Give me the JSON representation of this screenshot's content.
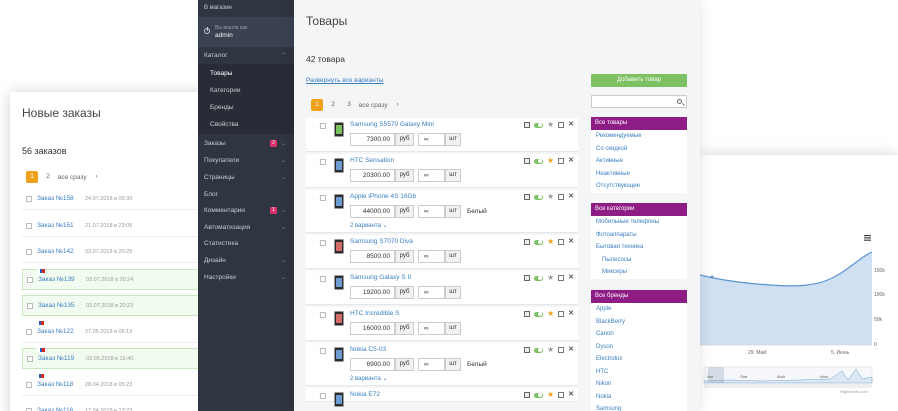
{
  "orders_card": {
    "title": "Новые заказы",
    "count": "56 заказов",
    "pager": {
      "pages": [
        "1",
        "2"
      ],
      "all": "все сразу",
      "next": "›"
    },
    "rows": [
      {
        "num": "Заказ №158",
        "date": "24.07.2018 в 09:30",
        "green": false,
        "flag": false
      },
      {
        "num": "Заказ №151",
        "date": "21.07.2018 в 23:05",
        "green": false,
        "flag": false
      },
      {
        "num": "Заказ №142",
        "date": "03.07.2018 в 20:25",
        "green": false,
        "flag": false
      },
      {
        "num": "Заказ №139",
        "date": "03.07.2018 в 20:24",
        "green": true,
        "flag": true
      },
      {
        "num": "Заказ №135",
        "date": "03.07.2018 в 20:23",
        "green": true,
        "flag": false
      },
      {
        "num": "Заказ №122",
        "date": "27.05.2018 в 05:13",
        "green": false,
        "flag": true
      },
      {
        "num": "Заказ №119",
        "date": "03.05.2018 в 15:40",
        "green": true,
        "flag": true
      },
      {
        "num": "Заказ №118",
        "date": "28.04.2018 в 05:23",
        "green": false,
        "flag": true
      },
      {
        "num": "Заказ №116",
        "date": "17.04.2018 в 13:23",
        "green": false,
        "flag": false
      }
    ]
  },
  "chart_card": {
    "y_ticks": [
      "150k",
      "100k",
      "50k",
      "0"
    ],
    "x_ticks": [
      "29. Май",
      "5. Июнь"
    ],
    "nav_labels": [
      "Авг",
      "Янв",
      "Май",
      "Июл"
    ],
    "credit": "Highcharts.com",
    "menu_icon": "hamburger-icon",
    "colors": {
      "area": "#cfe0f2",
      "line": "#5a94cf"
    }
  },
  "sidebar": {
    "to_shop": "В магазин",
    "logged_as": "Вы вошли как",
    "user": "admin",
    "items": [
      {
        "label": "Каталог",
        "chev": "⌃",
        "badge": ""
      },
      {
        "label": "Товары",
        "sub": true,
        "active": true
      },
      {
        "label": "Категории",
        "sub": true
      },
      {
        "label": "Бренды",
        "sub": true
      },
      {
        "label": "Свойства",
        "sub": true
      },
      {
        "label": "Заказы",
        "chev": "⌄",
        "badge": "2"
      },
      {
        "label": "Покупатели",
        "chev": "⌄",
        "badge": ""
      },
      {
        "label": "Страницы",
        "chev": "⌄",
        "badge": ""
      },
      {
        "label": "Блог",
        "chev": "",
        "badge": ""
      },
      {
        "label": "Комментарии",
        "chev": "⌄",
        "badge": "1"
      },
      {
        "label": "Автоматизация",
        "chev": "⌄",
        "badge": ""
      },
      {
        "label": "Статистика",
        "chev": "",
        "badge": ""
      },
      {
        "label": "Дизайн",
        "chev": "⌄",
        "badge": ""
      },
      {
        "label": "Настройки",
        "chev": "⌄",
        "badge": ""
      }
    ]
  },
  "main": {
    "title": "Товары",
    "count": "42 товара",
    "expand_all": "Развернуть все варианты",
    "pager": {
      "pages": [
        "1",
        "2",
        "3"
      ],
      "all": "все сразу",
      "next": "›"
    },
    "add_button": "Добавить товар",
    "search_placeholder": "",
    "products": [
      {
        "name": "Samsung S5570 Galaxy Mini",
        "price": "7300.00",
        "currency": "руб",
        "stock": "∞",
        "unit": "шт",
        "color": "",
        "variants": "",
        "star": false,
        "thumb": "green"
      },
      {
        "name": "HTC Sensation",
        "price": "20300.00",
        "currency": "руб",
        "stock": "∞",
        "unit": "шт",
        "color": "",
        "variants": "",
        "star": true,
        "thumb": "blue"
      },
      {
        "name": "Apple iPhone 4S 16Gb",
        "price": "44000.00",
        "currency": "руб",
        "stock": "∞",
        "unit": "шт",
        "color": "Белый",
        "variants": "2 варианта ⌄",
        "star": false,
        "thumb": "dark"
      },
      {
        "name": "Samsung S7070 Diva",
        "price": "8500.00",
        "currency": "руб",
        "stock": "∞",
        "unit": "шт",
        "color": "",
        "variants": "",
        "star": true,
        "thumb": "red"
      },
      {
        "name": "Samsung Galaxy S II",
        "price": "19200.00",
        "currency": "руб",
        "stock": "∞",
        "unit": "шт",
        "color": "",
        "variants": "",
        "star": false,
        "thumb": "blue"
      },
      {
        "name": "HTC Incredible S",
        "price": "16000.00",
        "currency": "руб",
        "stock": "∞",
        "unit": "шт",
        "color": "",
        "variants": "",
        "star": true,
        "thumb": "red"
      },
      {
        "name": "Nokia C5-03",
        "price": "6900.00",
        "currency": "руб",
        "stock": "∞",
        "unit": "шт",
        "color": "Белый",
        "variants": "2 варианта ⌄",
        "star": false,
        "thumb": "dark"
      },
      {
        "name": "Nokia E72",
        "price": "",
        "currency": "",
        "stock": "",
        "unit": "",
        "color": "",
        "variants": "",
        "star": true,
        "thumb": "dark"
      }
    ],
    "filters": [
      {
        "header": "Все товары",
        "items": [
          {
            "label": "Рекомендуемые"
          },
          {
            "label": "Со скидкой"
          },
          {
            "label": "Активные"
          },
          {
            "label": "Неактивные"
          },
          {
            "label": "Отсутствующие"
          }
        ]
      },
      {
        "header": "Все категории",
        "items": [
          {
            "label": "Мобильные телефоны"
          },
          {
            "label": "Фотоаппараты"
          },
          {
            "label": "Бытовая техника"
          },
          {
            "label": "Пылесосы",
            "sub": true
          },
          {
            "label": "Миксеры",
            "sub": true
          }
        ]
      },
      {
        "header": "Все бренды",
        "items": [
          {
            "label": "Apple"
          },
          {
            "label": "BlackBerry"
          },
          {
            "label": "Canon"
          },
          {
            "label": "Dyson"
          },
          {
            "label": "Electrolux"
          },
          {
            "label": "HTC"
          },
          {
            "label": "Nikon"
          },
          {
            "label": "Nokia"
          },
          {
            "label": "Samsung"
          }
        ]
      }
    ]
  },
  "colors": {
    "accent": "#8e1c85",
    "add_button": "#7dc163",
    "sidebar_bg": "#2f3541",
    "pager_active": "#f0a11b",
    "link": "#3a7fc1"
  }
}
